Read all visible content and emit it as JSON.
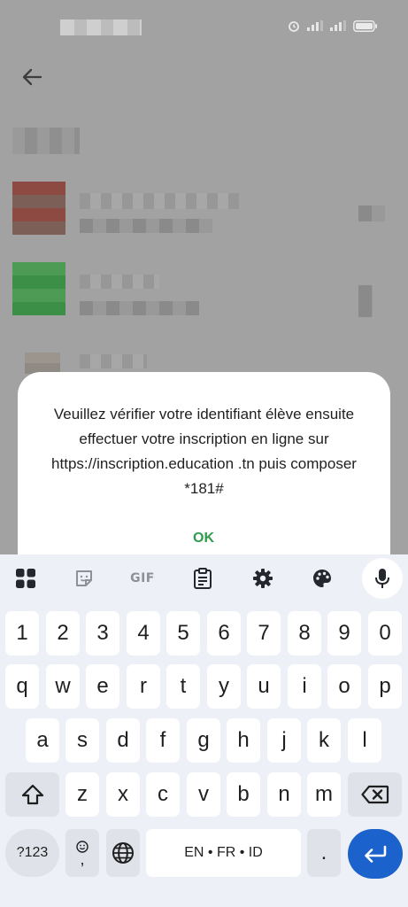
{
  "dialog": {
    "message": "Veuillez vérifier votre identifiant élève ensuite effectuer  votre inscription en ligne sur  https://inscription.education .tn puis composer *181#",
    "ok_label": "OK"
  },
  "keyboard": {
    "toolbar": {
      "items": [
        "apps-grid",
        "sticker",
        "gif",
        "clipboard",
        "settings",
        "theme-palette",
        "microphone"
      ],
      "gif_label": "GIF"
    },
    "number_row": [
      "1",
      "2",
      "3",
      "4",
      "5",
      "6",
      "7",
      "8",
      "9",
      "0"
    ],
    "row1": [
      "q",
      "w",
      "e",
      "r",
      "t",
      "y",
      "u",
      "i",
      "o",
      "p"
    ],
    "row2": [
      "a",
      "s",
      "d",
      "f",
      "g",
      "h",
      "j",
      "k",
      "l"
    ],
    "row3": [
      "z",
      "x",
      "c",
      "v",
      "b",
      "n",
      "m"
    ],
    "symbols_label": "?123",
    "emoji_comma_label": ",",
    "space_label": "EN • FR • ID",
    "period_label": "."
  },
  "colors": {
    "accent_green": "#2e9c4c",
    "enter_blue": "#1b62cc",
    "keyboard_bg": "#edf0f6",
    "scrim": "#a2a2a2"
  }
}
